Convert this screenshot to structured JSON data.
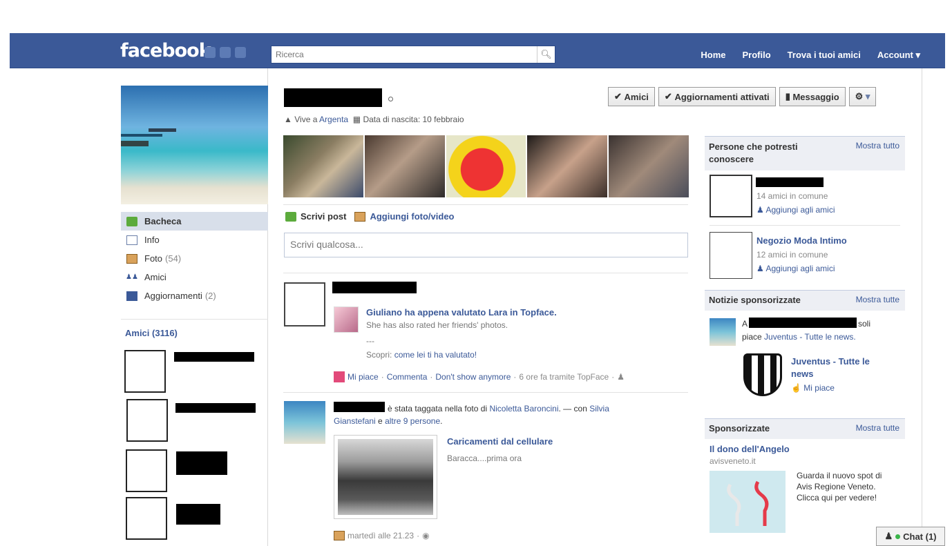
{
  "topbar": {
    "logo": "facebook",
    "search_placeholder": "Ricerca",
    "nav": [
      "Home",
      "Profilo",
      "Trova i tuoi amici",
      "Account ▾"
    ]
  },
  "profile": {
    "lives_in": "Vive a",
    "city": "Argenta",
    "birth_label": "Data di nascita:",
    "birth_date": "10 febbraio",
    "buttons": {
      "friends": "Amici",
      "updates": "Aggiornamenti attivati",
      "message": "Messaggio"
    }
  },
  "left_nav": [
    {
      "label": "Bacheca",
      "count": ""
    },
    {
      "label": "Info",
      "count": ""
    },
    {
      "label": "Foto",
      "count": "(54)"
    },
    {
      "label": "Amici",
      "count": ""
    },
    {
      "label": "Aggiornamenti",
      "count": "(2)"
    }
  ],
  "friends_heading": "Amici (3116)",
  "composer": {
    "write_post": "Scrivi post",
    "add_media": "Aggiungi foto/video",
    "placeholder": "Scrivi qualcosa..."
  },
  "post1": {
    "app_title": "Giuliano ha appena valutato Lara in Topface.",
    "app_sub": "She has also rated her friends' photos.",
    "dashes": "---",
    "discover_prefix": "Scopri:",
    "discover_link": "come lei ti ha valutato!",
    "like": "Mi piace",
    "comment": "Commenta",
    "hide": "Don't show anymore",
    "time": "6 ore fa tramite TopFace"
  },
  "post2": {
    "text_a": "è stata taggata nella foto di",
    "tagger": "Nicoletta Baroncini",
    "text_b": ". — con",
    "with1": "Silvia",
    "with1b": "Gianstefani",
    "text_c": "e",
    "others": "altre 9 persone",
    "album_title": "Caricamenti dal cellulare",
    "album_sub": "Baracca....prima ora",
    "time": "martedì alle 21.23"
  },
  "right": {
    "people": {
      "title": "Persone che potresti conoscere",
      "more": "Mostra tutto",
      "p1_mutual": "14 amici in comune",
      "add": "Aggiungi agli amici",
      "p2_name": "Negozio Moda Intimo",
      "p2_mutual": "12 amici in comune"
    },
    "sponsored_news": {
      "title": "Notizie sponsorizzate",
      "more": "Mostra tutte",
      "text_a": "A",
      "text_b": "soli",
      "text_c": "piace",
      "page_link": "Juventus - Tutte le news.",
      "page_name": "Juventus - Tutte le news",
      "like": "Mi piace"
    },
    "sponsored": {
      "title": "Sponsorizzate",
      "more": "Mostra tutte",
      "ad_title": "Il dono dell'Angelo",
      "ad_url": "avisveneto.it",
      "ad_text": "Guarda il nuovo spot di Avis Regione Veneto. Clicca qui per vedere!"
    }
  },
  "chat": "Chat (1)"
}
